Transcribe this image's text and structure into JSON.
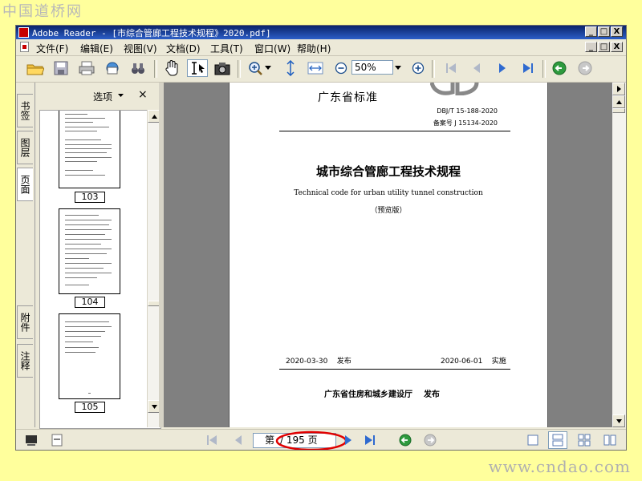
{
  "watermark_top": "中国道桥网",
  "watermark_bottom": "www.cndao.com",
  "window": {
    "title": "Adobe Reader - [市综合管廊工程技术规程》2020.pdf]",
    "minimize": "_",
    "restore": "□",
    "close": "X"
  },
  "menu": [
    "文件(F)",
    "编辑(E)",
    "视图(V)",
    "文档(D)",
    "工具(T)",
    "窗口(W)",
    "帮助(H)"
  ],
  "toolbar": {
    "zoom_value": "50%"
  },
  "side_tabs": [
    "书签",
    "图层",
    "页面",
    "附件",
    "注释"
  ],
  "panel": {
    "options_label": "选项",
    "close": "×",
    "thumbnails": [
      {
        "label": "103"
      },
      {
        "label": "104"
      },
      {
        "label": "105"
      }
    ]
  },
  "document": {
    "standard_header": "广东省标准",
    "code": "DBJ/T 15-188-2020",
    "record_no": "备案号 J 15134-2020",
    "title_cn": "城市综合管廊工程技术规程",
    "title_en": "Technical code for urban utility tunnel construction",
    "preview": "（预览版）",
    "issue_date": "2020-03-30",
    "issue_label": "发布",
    "effective_date": "2020-06-01",
    "effective_label": "实施",
    "issuer": "广东省住房和城乡建设厅",
    "issuer_action": "发布"
  },
  "status": {
    "page_prefix": "第",
    "page_total": "/ 195 页"
  },
  "colors": {
    "background": "#ffff9c",
    "titlebar": "#0a246a",
    "highlight_ellipse": "#e00000",
    "nav_green": "#2e9a3e"
  }
}
